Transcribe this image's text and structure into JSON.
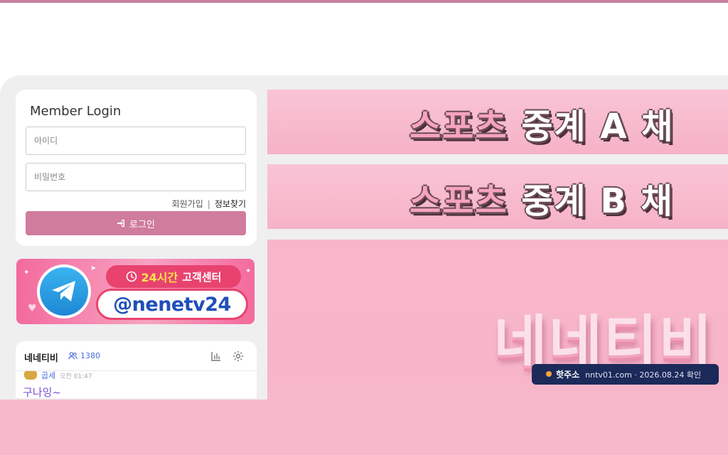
{
  "login": {
    "title": "Member Login",
    "id_placeholder": "아이디",
    "pw_placeholder": "비밀번호",
    "signup_link": "회원가입",
    "separator": "|",
    "find_link": "정보찾기",
    "login_button": "로그인",
    "accent_color": "#cf7c9d"
  },
  "telegram_banner": {
    "hours_label": "24시간",
    "center_label": "고객센터",
    "handle": "@nenetv24",
    "icon": "telegram-icon"
  },
  "chat": {
    "room_name": "네네티비",
    "user_count": "1380",
    "message_user": "곱세",
    "message_meta": "오전 01:47",
    "message_text": "구나잉~"
  },
  "channels": [
    {
      "prefix": "스포츠",
      "text": "중계 A 채"
    },
    {
      "prefix": "스포츠",
      "text": "중계 B 채"
    }
  ],
  "main_banner": {
    "brand": "네네티비"
  },
  "notice": {
    "label": "핫주소",
    "address": "nntv01.com · 2026.08.24 확인"
  }
}
